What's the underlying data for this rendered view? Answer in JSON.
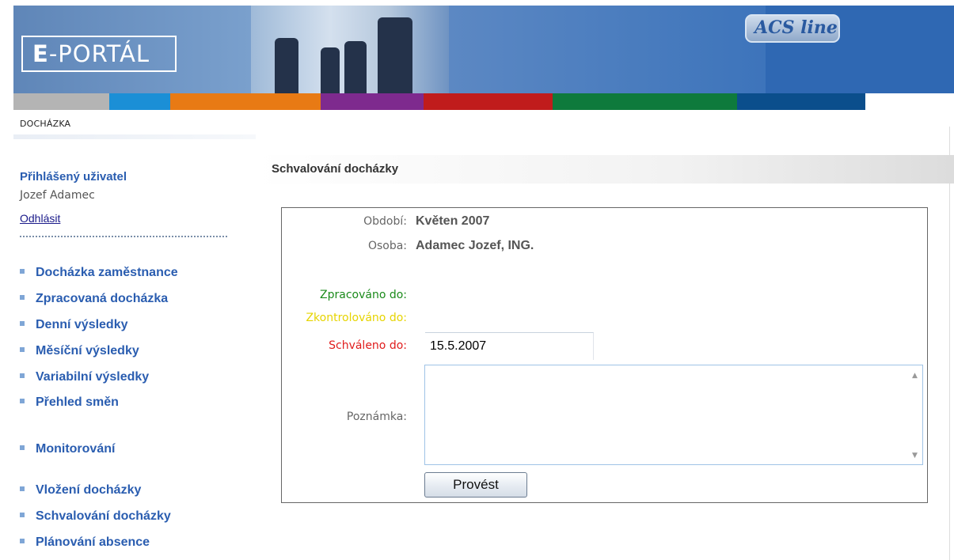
{
  "header": {
    "logo_bold": "E",
    "logo_text": "-PORTÁL",
    "brand_logo": "ACS line",
    "stripe_colors": [
      "#b4b4b4",
      "#1b8fd6",
      "#e87a14",
      "#7e2a8e",
      "#c01c1c",
      "#0e7a3c",
      "#0b4e8c",
      "#ffffff"
    ]
  },
  "breadcrumb": "DOCHÁZKA",
  "sidebar": {
    "user_label": "Přihlášený uživatel",
    "user_name": "Jozef Adamec",
    "logout": "Odhlásit",
    "items": [
      {
        "label": "Docházka zaměstnance"
      },
      {
        "label": "Zpracovaná docházka"
      },
      {
        "label": "Denní výsledky"
      },
      {
        "label": "Měsíční výsledky"
      },
      {
        "label": "Variabilní výsledky"
      },
      {
        "label": "Přehled směn"
      },
      {
        "label": "Monitorování"
      },
      {
        "label": "Vložení docházky"
      },
      {
        "label": "Schvalování docházky"
      },
      {
        "label": "Plánování absence"
      }
    ]
  },
  "main": {
    "title": "Schvalování docházky",
    "form": {
      "period_label": "Období:",
      "period_value": "Květen 2007",
      "person_label": "Osoba:",
      "person_value": "Adamec Jozef, ING.",
      "processed_label": "Zpracováno do:",
      "checked_label": "Zkontrolováno do:",
      "approved_label": "Schváleno do:",
      "approved_value": "15.5.2007",
      "note_label": "Poznámka:",
      "note_value": "",
      "submit_label": "Provést",
      "colors": {
        "processed": "#1a8a1a",
        "checked": "#e6d400",
        "approved": "#e01b1b",
        "label": "#666666"
      }
    }
  }
}
